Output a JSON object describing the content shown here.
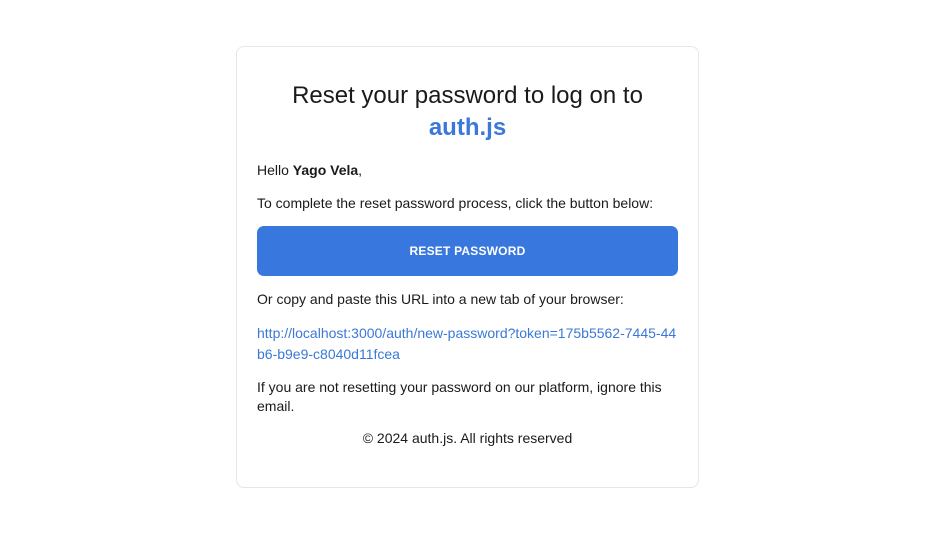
{
  "email": {
    "title": "Reset your password to log on to",
    "brand": "auth.js",
    "greeting_prefix": "Hello ",
    "user_name": "Yago Vela",
    "greeting_suffix": ",",
    "intro": "To complete the reset password process, click the button below:",
    "button_label": "RESET PASSWORD",
    "copy_text": "Or copy and paste this URL into a new tab of your browser:",
    "reset_url": "http://localhost:3000/auth/new-password?token=175b5562-7445-44b6-b9e9-c8040d11fcea",
    "ignore_text": "If you are not resetting your password on our platform, ignore this email.",
    "footer": "© 2024 auth.js. All rights reserved"
  },
  "colors": {
    "brand": "#3b78d8",
    "button_bg": "#3777de",
    "border": "#e6e6e6"
  }
}
